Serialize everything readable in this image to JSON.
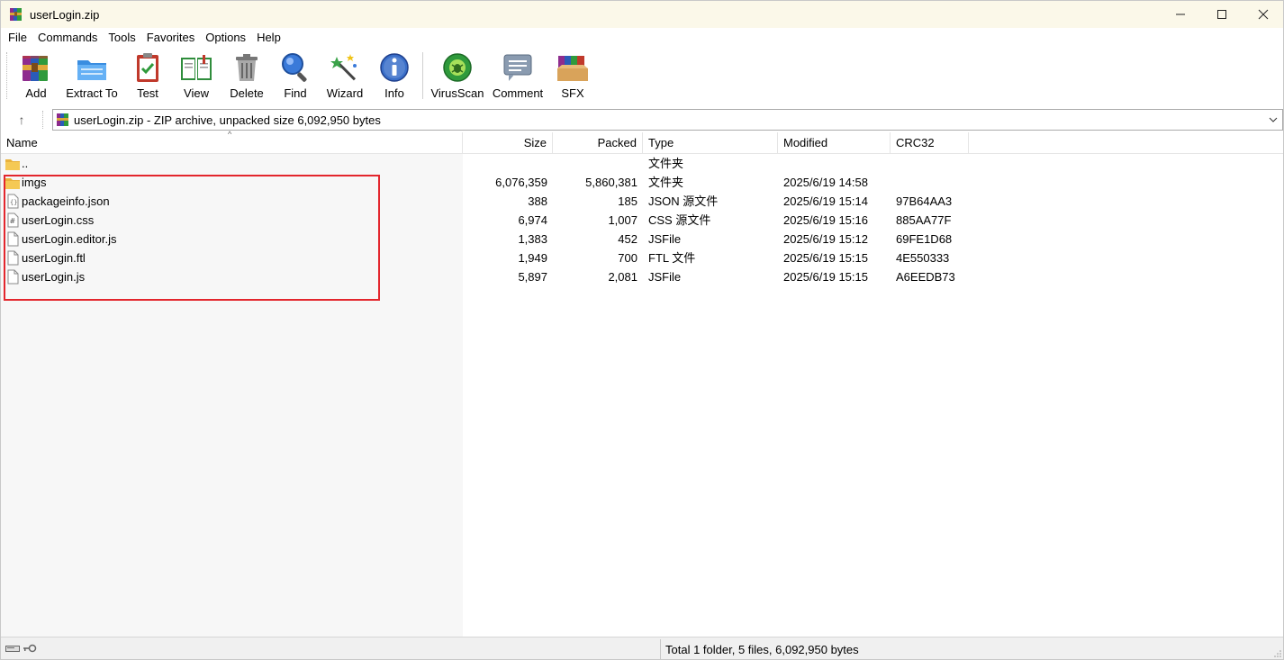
{
  "window": {
    "title": "userLogin.zip",
    "minimize_symbol": "—",
    "maximize_symbol": "☐",
    "close_symbol": "✕"
  },
  "menu": [
    "File",
    "Commands",
    "Tools",
    "Favorites",
    "Options",
    "Help"
  ],
  "toolbar": [
    {
      "label": "Add",
      "icon": "add-archive-icon"
    },
    {
      "label": "Extract To",
      "icon": "extract-folder-icon"
    },
    {
      "label": "Test",
      "icon": "test-clipboard-icon"
    },
    {
      "label": "View",
      "icon": "view-book-icon"
    },
    {
      "label": "Delete",
      "icon": "trash-icon"
    },
    {
      "label": "Find",
      "icon": "magnifier-icon"
    },
    {
      "label": "Wizard",
      "icon": "magic-wand-icon"
    },
    {
      "label": "Info",
      "icon": "info-icon"
    },
    {
      "label": "VirusScan",
      "icon": "virus-scan-icon"
    },
    {
      "label": "Comment",
      "icon": "comment-icon"
    },
    {
      "label": "SFX",
      "icon": "sfx-box-icon"
    }
  ],
  "address": {
    "text": "userLogin.zip - ZIP archive, unpacked size 6,092,950 bytes",
    "up_symbol": "↑",
    "dropdown_symbol": "⌵"
  },
  "columns": {
    "name": "Name",
    "size": "Size",
    "packed": "Packed",
    "type": "Type",
    "modified": "Modified",
    "crc": "CRC32",
    "sort_symbol": "^"
  },
  "files": [
    {
      "name": "..",
      "size": "",
      "packed": "",
      "type": "文件夹",
      "modified": "",
      "crc": "",
      "icon": "folder-icon"
    },
    {
      "name": "imgs",
      "size": "6,076,359",
      "packed": "5,860,381",
      "type": "文件夹",
      "modified": "2025/6/19 14:58",
      "crc": "",
      "icon": "folder-icon"
    },
    {
      "name": "packageinfo.json",
      "size": "388",
      "packed": "185",
      "type": "JSON 源文件",
      "modified": "2025/6/19 15:14",
      "crc": "97B64AA3",
      "icon": "json-file-icon"
    },
    {
      "name": "userLogin.css",
      "size": "6,974",
      "packed": "1,007",
      "type": "CSS 源文件",
      "modified": "2025/6/19 15:16",
      "crc": "885AA77F",
      "icon": "css-file-icon"
    },
    {
      "name": "userLogin.editor.js",
      "size": "1,383",
      "packed": "452",
      "type": "JSFile",
      "modified": "2025/6/19 15:12",
      "crc": "69FE1D68",
      "icon": "file-icon"
    },
    {
      "name": "userLogin.ftl",
      "size": "1,949",
      "packed": "700",
      "type": "FTL 文件",
      "modified": "2025/6/19 15:15",
      "crc": "4E550333",
      "icon": "file-icon"
    },
    {
      "name": "userLogin.js",
      "size": "5,897",
      "packed": "2,081",
      "type": "JSFile",
      "modified": "2025/6/19 15:15",
      "crc": "A6EEDB73",
      "icon": "file-icon"
    }
  ],
  "status": {
    "text": "Total 1 folder, 5 files, 6,092,950 bytes"
  },
  "colors": {
    "title_bar": "#fbf8e9",
    "highlight_box": "#e3262d",
    "folder": "#f5c242"
  }
}
